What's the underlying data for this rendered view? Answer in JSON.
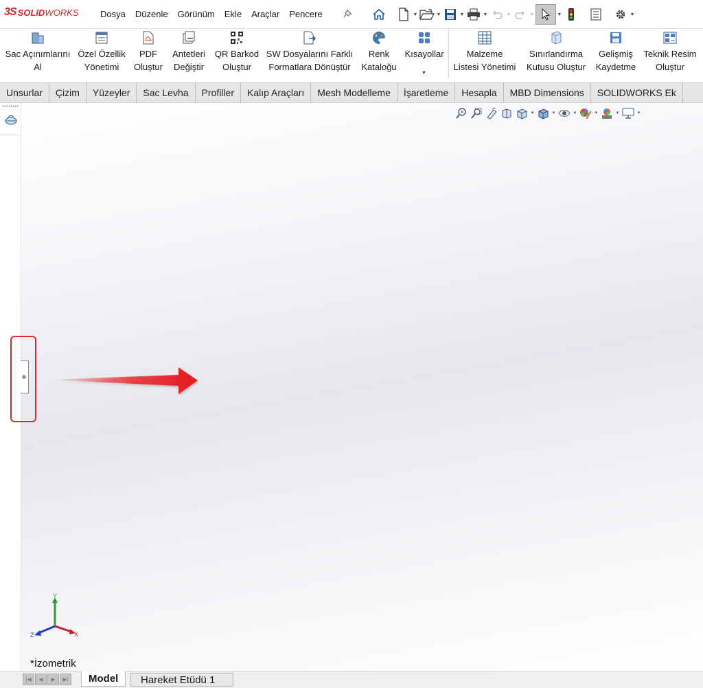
{
  "app": {
    "logo_ds": "3S",
    "logo_solid": "SOLID",
    "logo_works": "WORKS"
  },
  "menus": [
    "Dosya",
    "Düzenle",
    "Görünüm",
    "Ekle",
    "Araçlar",
    "Pencere"
  ],
  "quick_access": {
    "icons": [
      "home-icon",
      "new-document-icon",
      "open-folder-icon",
      "save-icon",
      "print-icon",
      "undo-icon",
      "redo-icon",
      "select-cursor-icon",
      "rebuild-traffic-light-icon",
      "file-properties-icon",
      "options-gear-icon"
    ]
  },
  "ribbon": {
    "items": [
      {
        "line1": "Sac Açınımlarını",
        "line2": "Al",
        "icon": "sheet-metal-flat-icon"
      },
      {
        "line1": "Özel Özellik",
        "line2": "Yönetimi",
        "icon": "custom-properties-icon"
      },
      {
        "line1": "PDF",
        "line2": "Oluştur",
        "icon": "pdf-icon"
      },
      {
        "line1": "Antetleri",
        "line2": "Değiştir",
        "icon": "title-block-icon"
      },
      {
        "line1": "QR Barkod",
        "line2": "Oluştur",
        "icon": "qr-code-icon"
      },
      {
        "line1": "SW Dosyalarını Farklı",
        "line2": "Formatlara Dönüştür",
        "icon": "convert-files-icon"
      },
      {
        "line1": "Renk",
        "line2": "Kataloğu",
        "icon": "color-palette-icon"
      },
      {
        "line1": "Kısayollar",
        "line2": "",
        "icon": "shortcuts-icon"
      },
      {
        "line1": "Malzeme",
        "line2": "Listesi Yönetimi",
        "icon": "bom-table-icon"
      },
      {
        "line1": "Sınırlandırma",
        "line2": "Kutusu Oluştur",
        "icon": "bounding-box-icon"
      },
      {
        "line1": "Gelişmiş",
        "line2": "Kaydetme",
        "icon": "advanced-save-icon"
      },
      {
        "line1": "Teknik Resim",
        "line2": "Oluştur",
        "icon": "drawing-create-icon"
      }
    ]
  },
  "command_tabs": [
    "Unsurlar",
    "Çizim",
    "Yüzeyler",
    "Sac Levha",
    "Profiller",
    "Kalıp Araçları",
    "Mesh Modelleme",
    "İşaretleme",
    "Hesapla",
    "MBD Dimensions",
    "SOLIDWORKS Ek"
  ],
  "heads_up_toolbar": {
    "icons": [
      "zoom-to-fit-icon",
      "zoom-to-area-icon",
      "previous-view-icon",
      "section-view-icon",
      "view-orientation-icon",
      "display-style-icon",
      "hide-show-items-icon",
      "edit-appearance-icon",
      "apply-scene-icon",
      "view-settings-icon"
    ]
  },
  "viewport": {
    "triad": {
      "x": "X",
      "y": "Y",
      "z": "Z"
    },
    "view_name": "*İzometrik",
    "colors": {
      "arrow": "#e8191d",
      "highlight_frame": "#e0262a"
    }
  },
  "bottom_tabs": [
    "Model",
    "Hareket Etüdü 1"
  ]
}
